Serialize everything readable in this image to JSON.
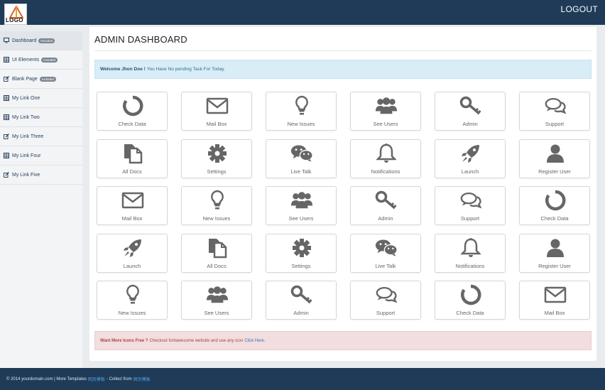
{
  "header": {
    "logo_text": "LOGO",
    "logout_label": "LOGOUT"
  },
  "sidebar": {
    "items": [
      {
        "label": "Dashboard",
        "badge": "Included",
        "icon": "desktop-icon"
      },
      {
        "label": "UI Elements",
        "badge": "Included",
        "icon": "table-icon"
      },
      {
        "label": "Blank Page",
        "badge": "Included",
        "icon": "edit-icon"
      },
      {
        "label": "My Link One",
        "badge": "",
        "icon": "table-icon"
      },
      {
        "label": "My Link Two",
        "badge": "",
        "icon": "table-icon"
      },
      {
        "label": "My Link Three",
        "badge": "",
        "icon": "edit-icon"
      },
      {
        "label": "My Link Four",
        "badge": "",
        "icon": "table-icon"
      },
      {
        "label": "My Link Five",
        "badge": "",
        "icon": "edit-icon"
      }
    ]
  },
  "main": {
    "title": "ADMIN DASHBOARD",
    "welcome_name": "Welcome Jhon Doe !",
    "welcome_text": "You Have No pending Task For Today.",
    "tiles": [
      [
        "Check Data",
        "Mail Box",
        "New Issues",
        "See Users",
        "Admin",
        "Support"
      ],
      [
        "All Docs",
        "Settings",
        "Live Talk",
        "Notifications",
        "Launch",
        "Register User"
      ],
      [
        "Mail Box",
        "New Issues",
        "See Users",
        "Admin",
        "Support",
        "Check Data"
      ],
      [
        "Launch",
        "All Docs",
        "Settings",
        "Live Talk",
        "Notifications",
        "Register User"
      ],
      [
        "New Issues",
        "See Users",
        "Admin",
        "Support",
        "Check Data",
        "Mail Box"
      ]
    ],
    "tile_icons": [
      [
        "circle-notch-icon",
        "envelope-icon",
        "lightbulb-icon",
        "users-icon",
        "key-icon",
        "comments-icon"
      ],
      [
        "copy-icon",
        "gear-icon",
        "wechat-icon",
        "bell-icon",
        "rocket-icon",
        "user-icon"
      ],
      [
        "envelope-icon",
        "lightbulb-icon",
        "users-icon",
        "key-icon",
        "comments-icon",
        "circle-notch-icon"
      ],
      [
        "rocket-icon",
        "copy-icon",
        "gear-icon",
        "wechat-icon",
        "bell-icon",
        "user-icon"
      ],
      [
        "lightbulb-icon",
        "users-icon",
        "key-icon",
        "comments-icon",
        "circle-notch-icon",
        "envelope-icon"
      ]
    ],
    "promo_bold": "Want More Icons Free ?",
    "promo_text": "Checkout fontawesome website and use any icon",
    "promo_link": "Click Here."
  },
  "footer": {
    "copyright": "© 2014 yourdomain.com | More Templates",
    "link1": "网页模板",
    "mid": "- Collect from",
    "link2": "网页模板"
  },
  "colors": {
    "navbar": "#1f3b57",
    "icon_gray": "#666666",
    "info_bg": "#d9edf7",
    "danger_bg": "#f2dede"
  }
}
